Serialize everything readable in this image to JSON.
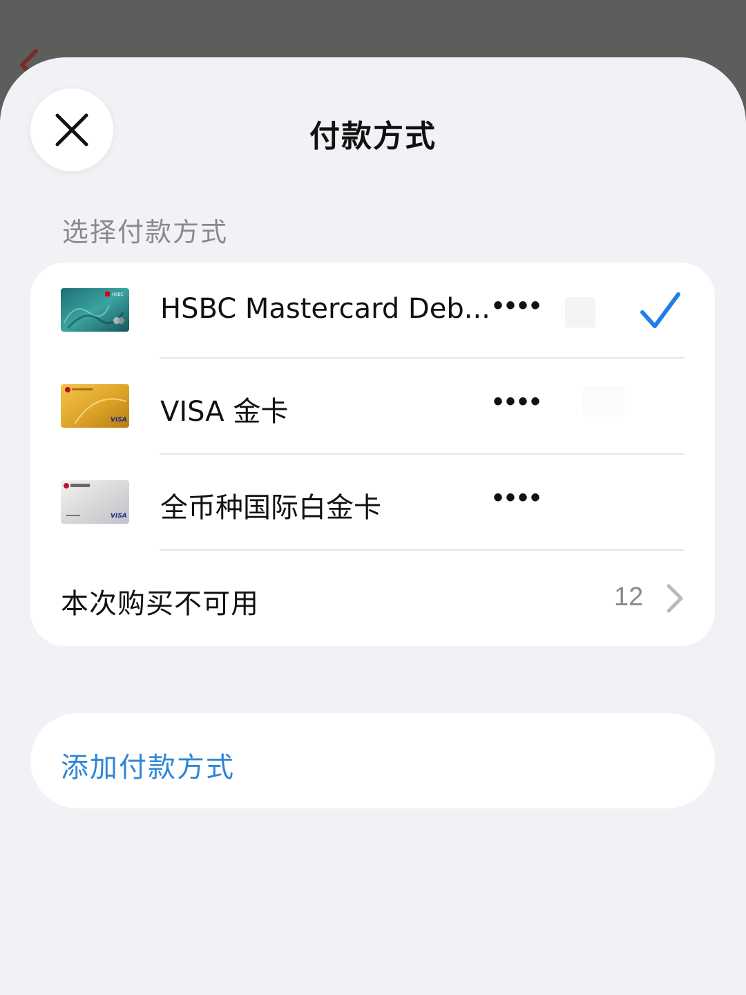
{
  "header": {
    "title": "付款方式"
  },
  "section": {
    "label": "选择付款方式"
  },
  "cards": [
    {
      "name": "HSBC Mastercard Deb...",
      "masked": "••••",
      "selected": true,
      "brand_text": "HSBC"
    },
    {
      "name": "VISA 金卡",
      "masked": "••••",
      "selected": false,
      "brand_text": "VISA"
    },
    {
      "name": "全币种国际白金卡",
      "masked": "••••",
      "selected": false,
      "brand_text": "VISA"
    }
  ],
  "unavailable": {
    "label": "本次购买不可用",
    "count": "12"
  },
  "add_method": {
    "label": "添加付款方式"
  },
  "colors": {
    "accent": "#2e86d6",
    "checkmark": "#1f7ee8",
    "sheet_bg": "#f2f2f6",
    "backdrop": "#5b5e5b"
  }
}
